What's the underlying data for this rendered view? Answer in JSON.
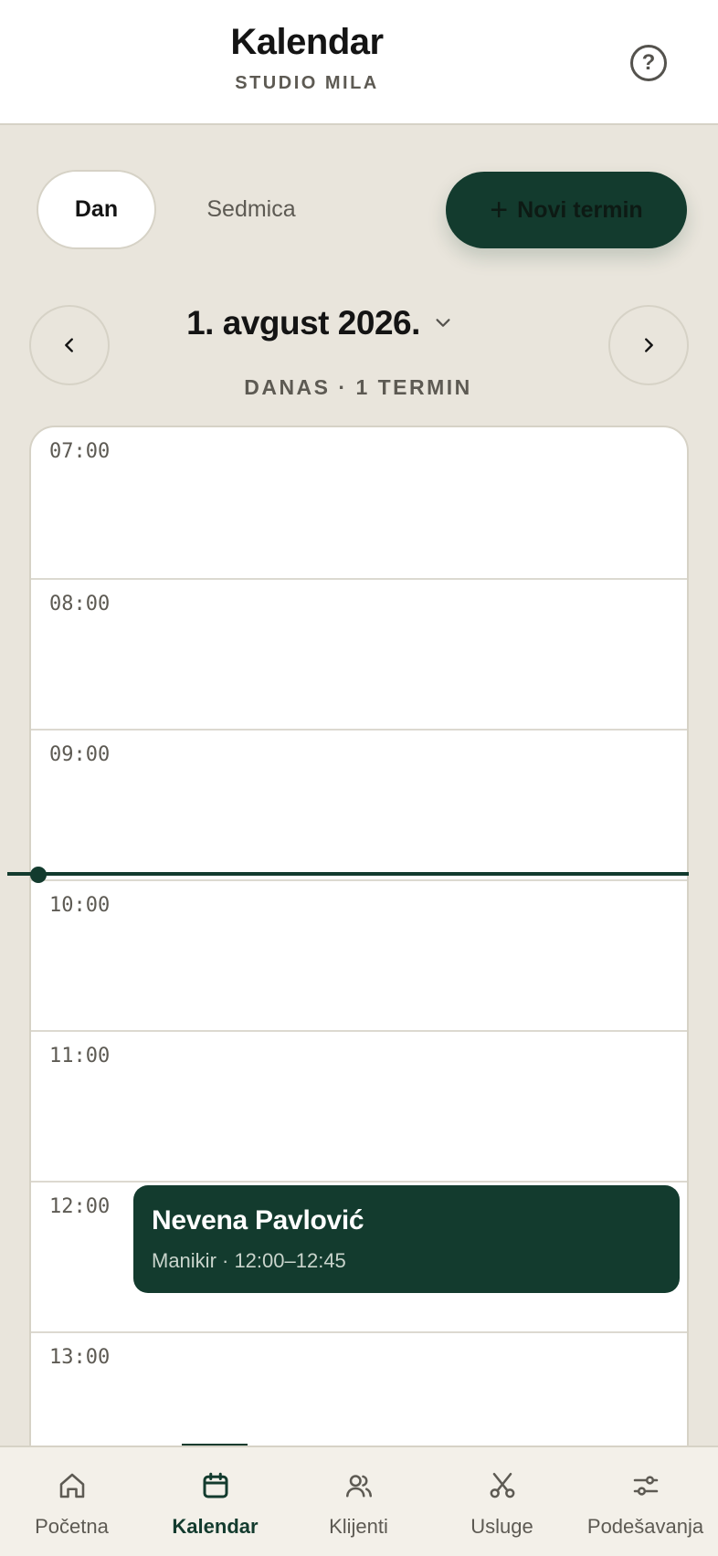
{
  "header": {
    "title": "Kalendar",
    "subtitle": "STUDIO MILA",
    "help_icon": "help-circle-icon"
  },
  "view_toggle": {
    "day_label": "Dan",
    "week_label": "Sedmica",
    "selected": "Dan"
  },
  "new_appointment": {
    "label": "Novi termin",
    "icon": "plus-icon"
  },
  "date_nav": {
    "date_label": "1. avgust 2026.",
    "summary": "DANAS · 1 TERMIN",
    "prev_icon": "chevron-left-icon",
    "next_icon": "chevron-right-icon",
    "dropdown_icon": "chevron-down-icon"
  },
  "timeline": {
    "hours": [
      "07:00",
      "08:00",
      "09:00",
      "10:00",
      "11:00",
      "12:00",
      "13:00"
    ],
    "events": [
      {
        "name": "Nevena Pavlović",
        "meta": "Manikir · 12:00–12:45"
      }
    ]
  },
  "bottom_nav": {
    "items": [
      {
        "label": "Početna",
        "icon": "home-icon"
      },
      {
        "label": "Kalendar",
        "icon": "calendar-icon"
      },
      {
        "label": "Klijenti",
        "icon": "users-icon"
      },
      {
        "label": "Usluge",
        "icon": "scissors-icon"
      },
      {
        "label": "Podešavanja",
        "icon": "sliders-icon"
      }
    ],
    "active": "Kalendar"
  },
  "colors": {
    "accent": "#133b2e",
    "background": "#e9e5dc",
    "surface": "#ffffff",
    "muted_text": "#5d5a53"
  }
}
